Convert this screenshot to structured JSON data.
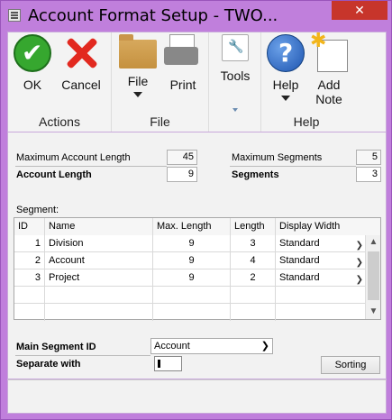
{
  "window": {
    "title": "Account Format Setup  -  TWO...",
    "close_glyph": "✕"
  },
  "ribbon": {
    "actions": {
      "label": "Actions",
      "ok": "OK",
      "cancel": "Cancel"
    },
    "file": {
      "label": "File",
      "file_button": "File",
      "print": "Print"
    },
    "tools": {
      "label": "",
      "tools_button": "Tools"
    },
    "help": {
      "label": "Help",
      "help_button": "Help",
      "add_note_line1": "Add",
      "add_note_line2": "Note"
    }
  },
  "summary": {
    "max_account_length_label": "Maximum Account Length",
    "max_account_length_value": "45",
    "account_length_label": "Account Length",
    "account_length_value": "9",
    "max_segments_label": "Maximum Segments",
    "max_segments_value": "5",
    "segments_label": "Segments",
    "segments_value": "3"
  },
  "segment_grid": {
    "caption": "Segment:",
    "headers": {
      "id": "ID",
      "name": "Name",
      "max_length": "Max. Length",
      "length": "Length",
      "display_width": "Display Width"
    },
    "rows": [
      {
        "id": "1",
        "name": "Division",
        "max_length": "9",
        "length": "3",
        "display_width": "Standard"
      },
      {
        "id": "2",
        "name": "Account",
        "max_length": "9",
        "length": "4",
        "display_width": "Standard"
      },
      {
        "id": "3",
        "name": "Project",
        "max_length": "9",
        "length": "2",
        "display_width": "Standard"
      }
    ]
  },
  "bottom": {
    "main_segment_label": "Main Segment ID",
    "main_segment_value": "Account",
    "separate_with_label": "Separate with",
    "sorting_button": "Sorting"
  }
}
